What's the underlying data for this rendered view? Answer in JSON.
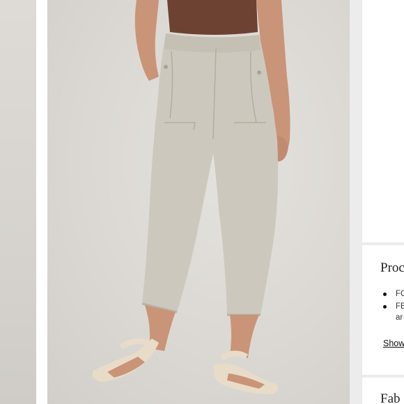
{
  "gallery": {
    "main_image": "linen-tapered-pants-photo",
    "thumbnail": "thumbnail-photo"
  },
  "product_details": {
    "heading": "Proc",
    "bullets": [
      {
        "text": "FC",
        "continuation": ""
      },
      {
        "text": "FE",
        "continuation": "ar"
      }
    ],
    "show_more_label": "Show"
  },
  "fabric": {
    "heading": "Fab"
  },
  "colors": {
    "page_bg": "#ececec",
    "panel_bg": "#ffffff",
    "pants": "#cdc8bd",
    "top": "#6e4232",
    "skin": "#c99478",
    "sandal": "#e8dcc8"
  }
}
